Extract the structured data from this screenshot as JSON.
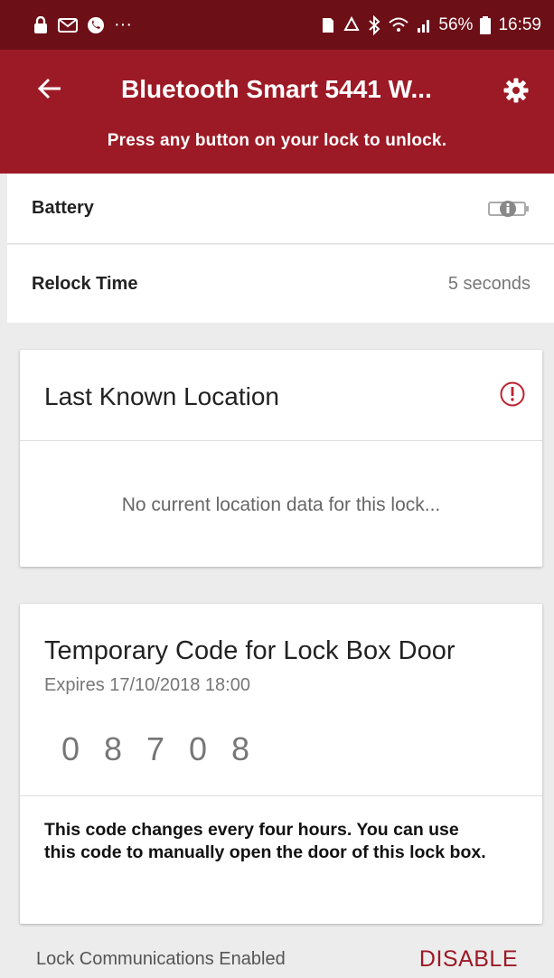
{
  "status_bar": {
    "battery": "56%",
    "time": "16:59",
    "dots": "···"
  },
  "app_bar": {
    "title": "Bluetooth Smart 5441 W...",
    "subtitle": "Press any button on your lock to unlock."
  },
  "settings": {
    "battery_label": "Battery",
    "relock_label": "Relock Time",
    "relock_value": "5 seconds"
  },
  "location_card": {
    "title": "Last Known Location",
    "message": "No current location data for this lock..."
  },
  "code_card": {
    "title": "Temporary Code for Lock Box Door",
    "expires": "Expires 17/10/2018 18:00",
    "digits": [
      "0",
      "8",
      "7",
      "0",
      "8"
    ],
    "note": "This code changes every four hours. You can use this code to manually open the door of this lock box."
  },
  "footer": {
    "status": "Lock Communications Enabled",
    "disable_label": "DISABLE"
  },
  "colors": {
    "app_bar": "#9c1a25",
    "status_bar": "#6d0f17",
    "accent": "#9c1a25"
  }
}
